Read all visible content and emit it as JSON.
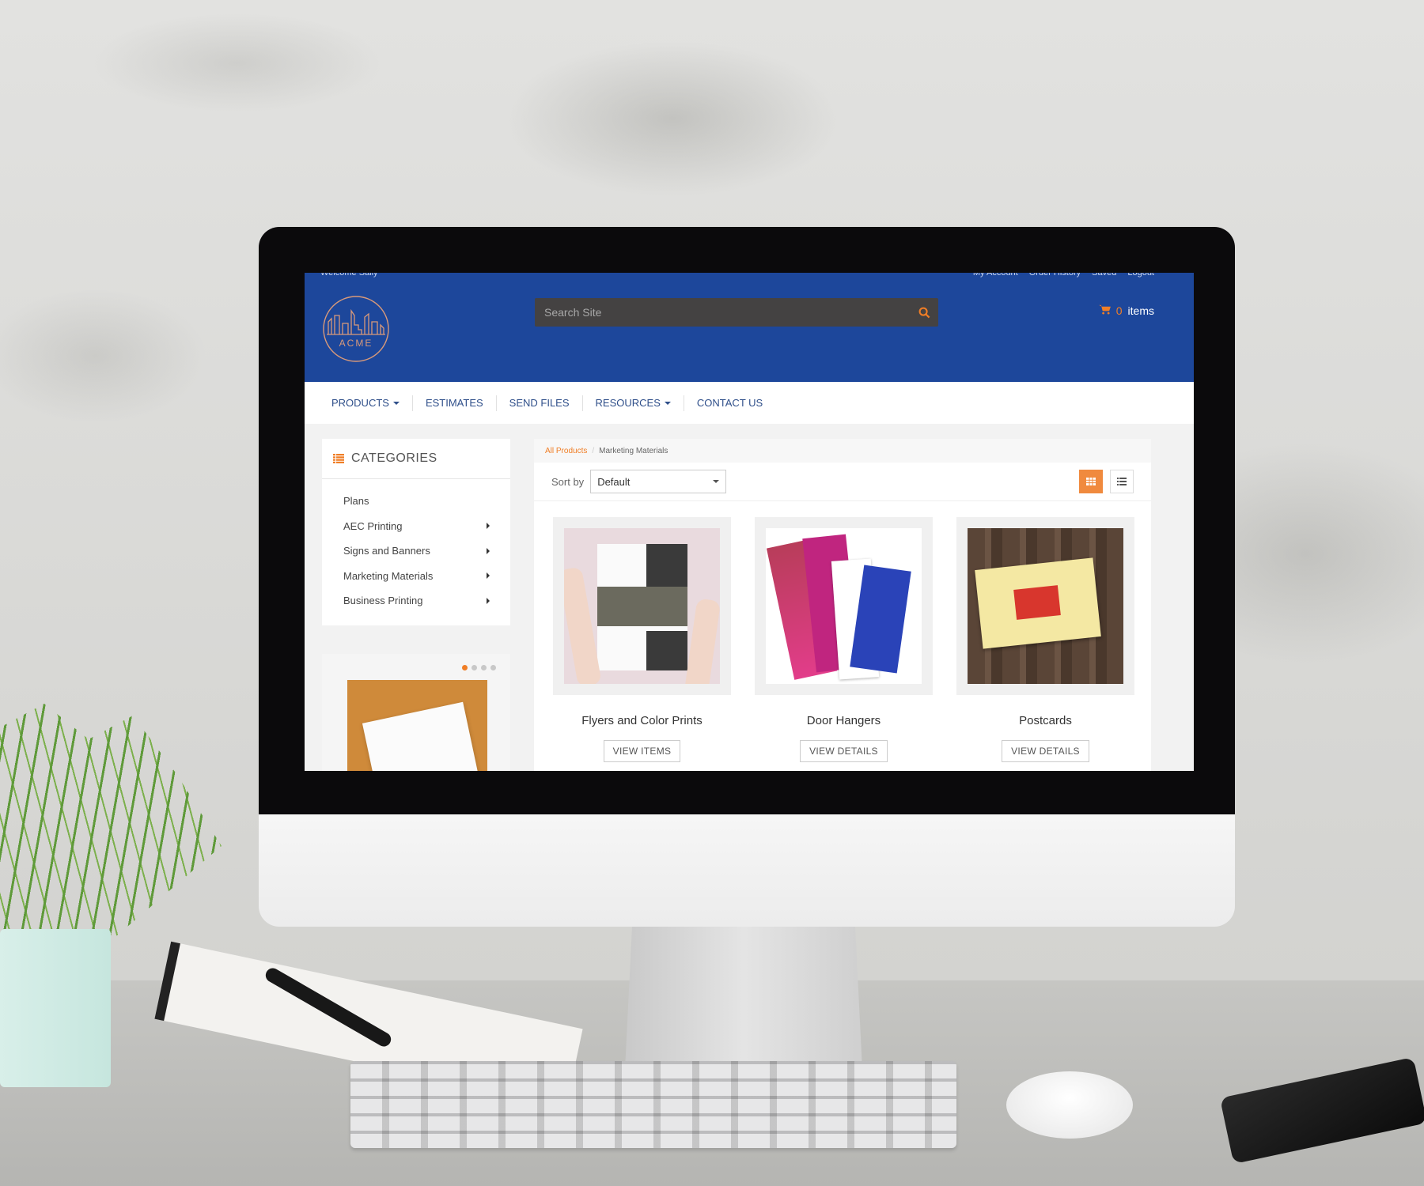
{
  "scene": {
    "description": "Desktop monitor on desk showing print shop storefront"
  },
  "topbar": {
    "welcome": "Welcome Sally",
    "links": [
      "My Account",
      "Order History",
      "Saved",
      "Logout"
    ]
  },
  "header": {
    "logo_text": "ACME",
    "search_placeholder": "Search Site",
    "cart_count": "0",
    "cart_label": "items"
  },
  "nav": {
    "items": [
      {
        "label": "PRODUCTS",
        "dropdown": true
      },
      {
        "label": "ESTIMATES",
        "dropdown": false
      },
      {
        "label": "SEND FILES",
        "dropdown": false
      },
      {
        "label": "RESOURCES",
        "dropdown": true
      },
      {
        "label": "CONTACT US",
        "dropdown": false
      }
    ]
  },
  "sidebar": {
    "title": "CATEGORIES",
    "items": [
      {
        "label": "Plans",
        "has_children": false
      },
      {
        "label": "AEC Printing",
        "has_children": true
      },
      {
        "label": "Signs and Banners",
        "has_children": true
      },
      {
        "label": "Marketing Materials",
        "has_children": true
      },
      {
        "label": "Business Printing",
        "has_children": true
      }
    ],
    "carousel": {
      "slides": 4,
      "active": 1
    }
  },
  "breadcrumb": {
    "root": "All Products",
    "separator": "/",
    "current": "Marketing Materials"
  },
  "toolbar": {
    "sort_label": "Sort by",
    "sort_value": "Default",
    "view_mode": "grid"
  },
  "products": [
    {
      "title": "Flyers and Color Prints",
      "button": "VIEW ITEMS"
    },
    {
      "title": "Door Hangers",
      "button": "VIEW DETAILS"
    },
    {
      "title": "Postcards",
      "button": "VIEW DETAILS"
    }
  ],
  "colors": {
    "brand_blue": "#1d479b",
    "accent_orange": "#f07e26",
    "search_bg": "#444242"
  }
}
